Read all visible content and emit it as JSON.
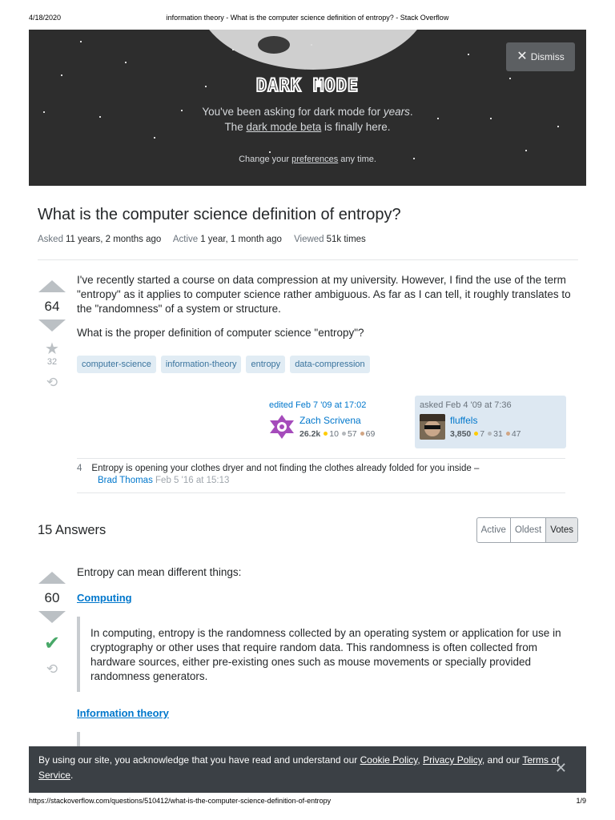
{
  "print_header": {
    "date": "4/18/2020",
    "title": "information theory - What is the computer science definition of entropy? - Stack Overflow"
  },
  "dark_mode_banner": {
    "title": "DARK MODE",
    "line1_prefix": "You've been asking for dark mode for ",
    "line1_emphasis": "years",
    "line1_suffix": ".",
    "line2_prefix": "The ",
    "line2_link": "dark mode beta",
    "line2_suffix": " is finally here.",
    "line3_prefix": "Change your ",
    "line3_link": "preferences",
    "line3_suffix": " any time.",
    "dismiss_label": "Dismiss"
  },
  "question": {
    "title": "What is the computer science definition of entropy?",
    "meta": {
      "asked_label": "Asked",
      "asked_value": "11 years, 2 months ago",
      "active_label": "Active",
      "active_value": "1 year, 1 month ago",
      "viewed_label": "Viewed",
      "viewed_value": "51k times"
    },
    "votes": "64",
    "favorites": "32",
    "body_p1": "I've recently started a course on data compression at my university. However, I find the use of the term \"entropy\" as it applies to computer science rather ambiguous. As far as I can tell, it roughly translates to the \"randomness\" of a system or structure.",
    "body_p2": "What is the proper definition of computer science \"entropy\"?",
    "tags": [
      "computer-science",
      "information-theory",
      "entropy",
      "data-compression"
    ],
    "editor": {
      "action": "edited Feb 7 '09 at 17:02",
      "name": "Zach Scrivena",
      "reputation": "26.2k",
      "gold": "10",
      "silver": "57",
      "bronze": "69"
    },
    "owner": {
      "action": "asked Feb 4 '09 at 7:36",
      "name": "fluffels",
      "reputation": "3,850",
      "gold": "7",
      "silver": "31",
      "bronze": "47"
    },
    "comment": {
      "score": "4",
      "text": "Entropy is opening your clothes dryer and not finding the clothes already folded for you inside –",
      "author": "Brad Thomas",
      "time": "Feb 5 '16 at 15:13"
    }
  },
  "answers": {
    "count_label": "15 Answers",
    "sort_tabs": [
      "Active",
      "Oldest",
      "Votes"
    ],
    "first": {
      "votes": "60",
      "intro": "Entropy can mean different things:",
      "heading1": "Computing",
      "quote1": "In computing, entropy is the randomness collected by an operating system or application for use in cryptography or other uses that require random data. This randomness is often collected from hardware sources, either pre-existing ones such as mouse movements or specially provided randomness generators.",
      "heading2": "Information theory"
    }
  },
  "cookie_notice": {
    "prefix": "By using our site, you acknowledge that you have read and understand our ",
    "link1": "Cookie Policy",
    "sep1": ", ",
    "link2": "Privacy Policy",
    "sep2": ", and our ",
    "link3": "Terms of Service",
    "suffix": "."
  },
  "print_footer": {
    "url": "https://stackoverflow.com/questions/510412/what-is-the-computer-science-definition-of-entropy",
    "page": "1/9"
  },
  "colors": {
    "banner_bg": "#2d2d2d",
    "link_blue": "#0077cc",
    "tag_bg": "#e1ecf4",
    "tag_text": "#39739d",
    "accepted_green": "#48a868",
    "cookie_bg": "#3b4045"
  },
  "icons": [
    "close-icon",
    "upvote-arrow-icon",
    "downvote-arrow-icon",
    "star-icon",
    "history-icon",
    "accepted-check-icon"
  ]
}
